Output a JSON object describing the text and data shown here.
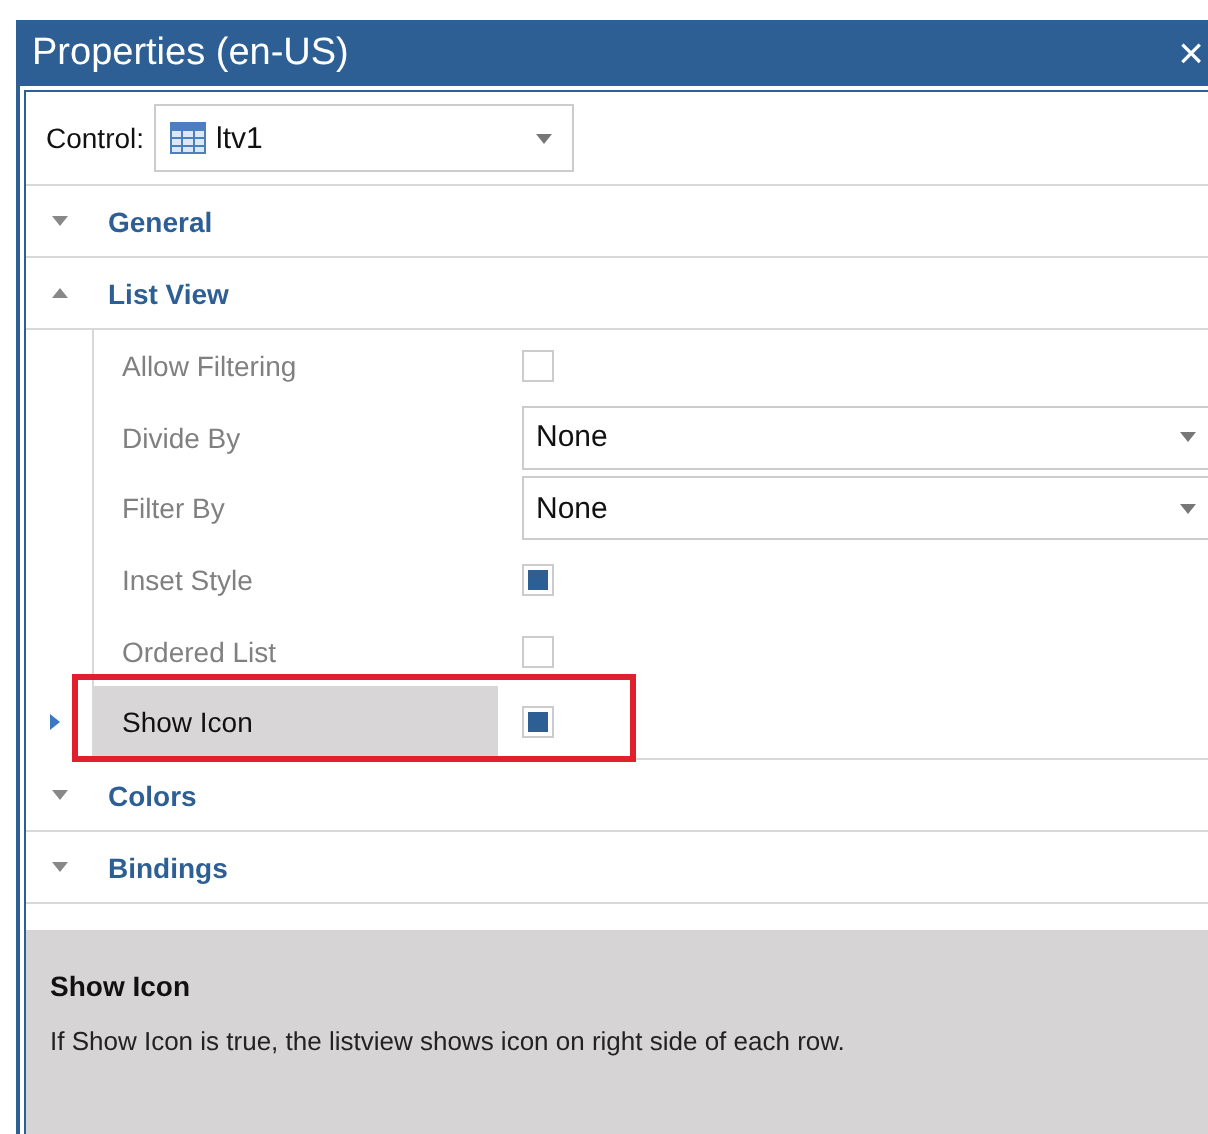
{
  "window": {
    "title": "Properties (en-US)",
    "close": "×"
  },
  "control": {
    "label": "Control:",
    "value": "ltv1"
  },
  "sections": [
    {
      "label": "General",
      "expanded": false
    },
    {
      "label": "List View",
      "expanded": true,
      "properties": [
        {
          "label": "Allow Filtering",
          "kind": "checkbox",
          "checked": false,
          "selected": false
        },
        {
          "label": "Divide By",
          "kind": "dropdown",
          "value": "None",
          "selected": false
        },
        {
          "label": "Filter By",
          "kind": "dropdown",
          "value": "None",
          "selected": false
        },
        {
          "label": "Inset Style",
          "kind": "checkbox",
          "checked": true,
          "selected": false
        },
        {
          "label": "Ordered List",
          "kind": "checkbox",
          "checked": false,
          "selected": false
        },
        {
          "label": "Show Icon",
          "kind": "checkbox",
          "checked": true,
          "selected": true
        }
      ]
    },
    {
      "label": "Colors",
      "expanded": false
    },
    {
      "label": "Bindings",
      "expanded": false
    }
  ],
  "description": {
    "title": "Show Icon",
    "text": "If Show Icon is true, the listview shows icon on right side of each row."
  }
}
